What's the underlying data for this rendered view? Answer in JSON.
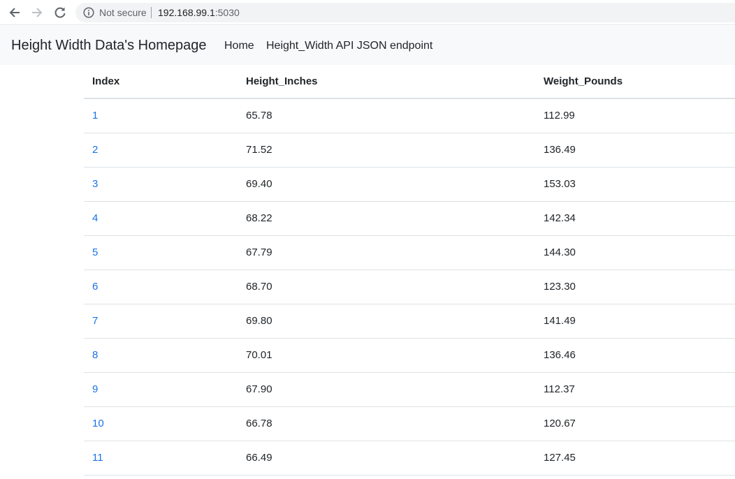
{
  "browser": {
    "security_label": "Not secure",
    "url_host": "192.168.99.1",
    "url_port": ":5030",
    "icons": {
      "back": "arrow-left-icon",
      "forward": "arrow-right-icon",
      "reload": "reload-icon",
      "info": "info-icon"
    }
  },
  "navbar": {
    "brand": "Height Width Data's Homepage",
    "links": [
      {
        "label": "Home"
      },
      {
        "label": "Height_Width API JSON endpoint"
      }
    ]
  },
  "table": {
    "headers": [
      "Index",
      "Height_Inches",
      "Weight_Pounds"
    ],
    "rows": [
      {
        "index": "1",
        "height": "65.78",
        "weight": "112.99"
      },
      {
        "index": "2",
        "height": "71.52",
        "weight": "136.49"
      },
      {
        "index": "3",
        "height": "69.40",
        "weight": "153.03"
      },
      {
        "index": "4",
        "height": "68.22",
        "weight": "142.34"
      },
      {
        "index": "5",
        "height": "67.79",
        "weight": "144.30"
      },
      {
        "index": "6",
        "height": "68.70",
        "weight": "123.30"
      },
      {
        "index": "7",
        "height": "69.80",
        "weight": "141.49"
      },
      {
        "index": "8",
        "height": "70.01",
        "weight": "136.46"
      },
      {
        "index": "9",
        "height": "67.90",
        "weight": "112.37"
      },
      {
        "index": "10",
        "height": "66.78",
        "weight": "120.67"
      },
      {
        "index": "11",
        "height": "66.49",
        "weight": "127.45"
      }
    ]
  },
  "colors": {
    "link": "#1a73e8",
    "navbar_bg": "#f8f9fa",
    "omnibox_bg": "#f1f3f4"
  }
}
